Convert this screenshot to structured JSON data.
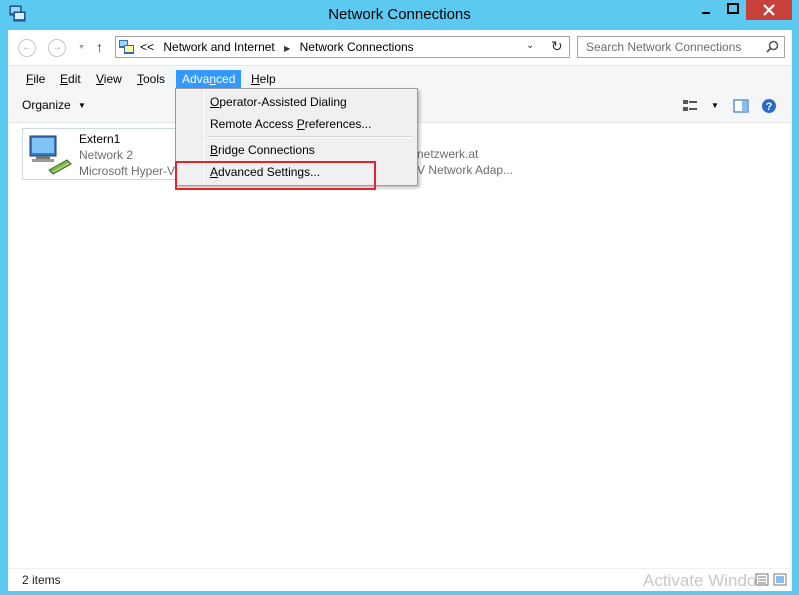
{
  "window": {
    "title": "Network Connections",
    "controls": {
      "minimize_icon": "minimize-icon",
      "maximize_icon": "maximize-icon",
      "close_icon": "close-icon"
    },
    "close_color": "#c7403a",
    "frame_color": "#5ccaf0"
  },
  "address": {
    "overflow": "<<",
    "crumbs": [
      "Network and Internet",
      "Network Connections"
    ],
    "search_placeholder": "Search Network Connections"
  },
  "menubar": {
    "items": [
      "File",
      "Edit",
      "View",
      "Tools",
      "Advanced",
      "Help"
    ],
    "active": "Advanced",
    "active_color": "#3399ff"
  },
  "toolbar": {
    "organize_label": "Organize"
  },
  "content": {
    "item": {
      "name": "Extern1",
      "line2": "Network  2",
      "line3": "Microsoft Hyper-V"
    },
    "partial_name_tail": "-netzwerk.at",
    "partial_adapter_tail": "-V Network Adap..."
  },
  "advanced_menu": {
    "items": [
      "Operator-Assisted Dialing",
      "Remote Access Preferences...",
      "Bridge Connections",
      "Advanced Settings..."
    ],
    "highlighted": "Advanced Settings...",
    "highlight_color": "#e0232e"
  },
  "status": {
    "count": "2 items",
    "watermark": "Activate Window"
  }
}
